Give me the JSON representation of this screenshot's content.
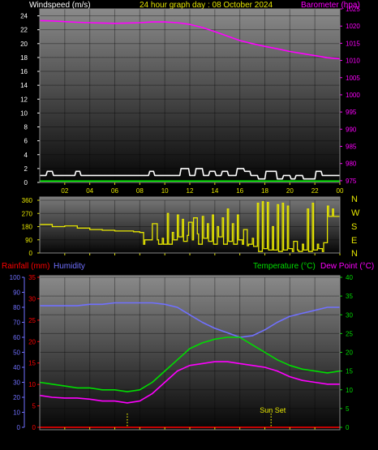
{
  "header": {
    "left_label": "Windspeed (m/s)",
    "center_label": "24 hour graph day : 08 October 2024",
    "right_label": "Barometer (hpa)"
  },
  "colors": {
    "wind": "#ffffff",
    "wind_avg": "#00ff00",
    "baro": "#ff00ff",
    "dir": "#e6e600",
    "rain": "#ff0000",
    "humidity": "#7070ff",
    "temperature": "#00dd00",
    "dewpoint": "#ff00ff",
    "time": "#e6e600",
    "sunset": "#e6e600"
  },
  "compass": [
    "N",
    "W",
    "S",
    "E",
    "N"
  ],
  "lower_header": {
    "rain_label": "Rainfall (mm)",
    "humidity_label": "Humidity",
    "temp_label": "Temperature (°C)",
    "dew_label": "Dew Point (°C)"
  },
  "sunset_label": "Sun Set",
  "chart_data": [
    {
      "type": "line",
      "xlabel": "",
      "xticks": [
        "02",
        "04",
        "06",
        "08",
        "10",
        "12",
        "14",
        "16",
        "18",
        "20",
        "22",
        "00"
      ],
      "xlim": [
        0,
        24
      ],
      "y_left": {
        "label": "Windspeed (m/s)",
        "lim": [
          0,
          25
        ],
        "ticks": [
          0,
          2,
          4,
          6,
          8,
          10,
          12,
          14,
          16,
          18,
          20,
          22,
          24
        ]
      },
      "y_right": {
        "label": "Barometer (hpa)",
        "lim": [
          974.5,
          1025
        ],
        "ticks": [
          975,
          980,
          985,
          990,
          995,
          1000,
          1005,
          1010,
          1015,
          1020,
          1025
        ]
      },
      "series": [
        {
          "name": "Windspeed",
          "axis": "left",
          "color_key": "wind",
          "x": [
            0,
            0.5,
            0.6,
            1.0,
            1.1,
            2.8,
            2.9,
            3.2,
            3.3,
            8.7,
            8.8,
            9.1,
            9.2,
            11.2,
            11.3,
            11.9,
            12.0,
            12.4,
            12.5,
            13.0,
            13.1,
            13.5,
            13.6,
            14.0,
            14.1,
            14.5,
            14.6,
            15.0,
            15.1,
            15.7,
            15.8,
            16.3,
            16.4,
            16.8,
            16.9,
            17.4,
            17.5,
            18.0,
            18.1,
            18.9,
            19.0,
            19.4,
            19.5,
            20.0,
            20.1,
            20.4,
            20.5,
            21.0,
            21.1,
            22.0,
            22.1,
            22.5,
            22.6,
            24
          ],
          "y": [
            1,
            1,
            1.6,
            1.6,
            1,
            1,
            1.6,
            1.6,
            1,
            1,
            1.6,
            1.6,
            1,
            1,
            2,
            2,
            1,
            1,
            2,
            2,
            1,
            1,
            1.6,
            1.6,
            1,
            1,
            1.6,
            1.6,
            1,
            1,
            2,
            2,
            1.6,
            1.6,
            1,
            1,
            0.5,
            0.5,
            1.6,
            1.6,
            0.5,
            0.5,
            1,
            1,
            0.5,
            0.5,
            1,
            1,
            0.5,
            0.5,
            1.6,
            1.6,
            1,
            1
          ]
        },
        {
          "name": "Wind average",
          "axis": "left",
          "color_key": "wind_avg",
          "x": [
            0,
            24
          ],
          "y": [
            0.2,
            0.2
          ]
        },
        {
          "name": "Barometer",
          "axis": "right",
          "color_key": "baro",
          "x": [
            0,
            1,
            2,
            3,
            4,
            5,
            6,
            7,
            8,
            9,
            10,
            11,
            12,
            13,
            14,
            15,
            16,
            17,
            18,
            19,
            20,
            21,
            22,
            23,
            24
          ],
          "y": [
            1021.6,
            1021.5,
            1021.3,
            1021.1,
            1021.0,
            1020.9,
            1020.8,
            1020.9,
            1021.0,
            1021.2,
            1021.2,
            1021.0,
            1020.5,
            1019.6,
            1018.4,
            1017.1,
            1015.8,
            1014.9,
            1014.1,
            1013.4,
            1012.6,
            1012.0,
            1011.4,
            1010.8,
            1010.5
          ]
        }
      ]
    },
    {
      "type": "line",
      "xlim": [
        0,
        24
      ],
      "y_left": {
        "label": "",
        "lim": [
          0,
          360
        ],
        "ticks": [
          0,
          90,
          180,
          270,
          360
        ]
      },
      "y_right": {
        "label": "",
        "ticks_text": [
          "N",
          "W",
          "S",
          "E",
          "N"
        ]
      },
      "series": [
        {
          "name": "Wind direction",
          "axis": "left",
          "color_key": "dir",
          "x": [
            0,
            1,
            2,
            3,
            4,
            5,
            6,
            7,
            7.5,
            8,
            8.3,
            8.4,
            9,
            9.4,
            9.5,
            9.8,
            9.9,
            10.2,
            10.3,
            10.6,
            10.7,
            11.0,
            11.1,
            11.4,
            11.5,
            11.8,
            11.9,
            12.2,
            12.3,
            12.6,
            12.7,
            13.0,
            13.1,
            13.4,
            13.5,
            13.8,
            13.9,
            14.2,
            14.3,
            14.6,
            14.7,
            15.0,
            15.1,
            15.4,
            15.5,
            15.8,
            15.9,
            16.2,
            16.3,
            16.6,
            16.7,
            17.0,
            17.1,
            17.4,
            17.5,
            17.8,
            17.9,
            18.2,
            18.3,
            18.6,
            18.7,
            19.0,
            19.1,
            19.4,
            19.5,
            19.8,
            19.9,
            20.2,
            20.3,
            20.6,
            20.7,
            21.0,
            21.1,
            21.4,
            21.5,
            21.8,
            21.9,
            22.2,
            22.3,
            22.6,
            22.7,
            23.0,
            23.1,
            23.4,
            23.5,
            24
          ],
          "y": [
            190,
            195,
            180,
            185,
            170,
            160,
            155,
            150,
            150,
            145,
            140,
            60,
            90,
            200,
            90,
            60,
            100,
            60,
            270,
            60,
            140,
            90,
            260,
            110,
            230,
            80,
            120,
            210,
            90,
            240,
            130,
            60,
            250,
            100,
            200,
            80,
            260,
            60,
            180,
            110,
            240,
            60,
            300,
            80,
            200,
            60,
            260,
            90,
            60,
            160,
            50,
            60,
            100,
            45,
            340,
            10,
            350,
            30,
            345,
            20,
            180,
            20,
            330,
            10,
            340,
            20,
            320,
            30,
            10,
            80,
            20,
            10,
            60,
            20,
            300,
            10,
            340,
            20,
            60,
            30,
            10,
            70,
            320,
            250,
            300,
            250
          ]
        }
      ]
    },
    {
      "type": "line",
      "xlim": [
        0,
        24
      ],
      "y_left_outer": {
        "label": "Humidity",
        "lim": [
          0,
          100
        ],
        "ticks": [
          0,
          10,
          20,
          30,
          40,
          50,
          60,
          70,
          80,
          90,
          100
        ]
      },
      "y_left_inner": {
        "label": "Rainfall (mm)",
        "lim": [
          0,
          35
        ],
        "ticks": [
          0,
          5,
          10,
          15,
          20,
          25,
          30,
          35
        ]
      },
      "y_right": {
        "label": "Temperature (°C)",
        "lim": [
          0,
          40
        ],
        "ticks": [
          0,
          5,
          10,
          15,
          20,
          25,
          30,
          35,
          40
        ]
      },
      "series": [
        {
          "name": "Humidity",
          "axis": "humidity",
          "color_key": "humidity",
          "x": [
            0,
            1,
            2,
            3,
            4,
            5,
            6,
            7,
            8,
            9,
            10,
            11,
            12,
            13,
            14,
            15,
            16,
            17,
            18,
            19,
            20,
            21,
            22,
            23,
            24
          ],
          "y": [
            81,
            81,
            81,
            81,
            82,
            82,
            83,
            83,
            83,
            83,
            82,
            80,
            75,
            70,
            66,
            63,
            60,
            61,
            65,
            70,
            74,
            76,
            78,
            80,
            80
          ]
        },
        {
          "name": "Temperature",
          "axis": "right",
          "color_key": "temperature",
          "x": [
            0,
            1,
            2,
            3,
            4,
            5,
            6,
            7,
            8,
            9,
            10,
            11,
            12,
            13,
            14,
            15,
            16,
            17,
            18,
            19,
            20,
            21,
            22,
            23,
            24
          ],
          "y": [
            12,
            11.5,
            11,
            10.5,
            10.5,
            10,
            10,
            9.5,
            10,
            12,
            15,
            18,
            21,
            22.5,
            23.5,
            24,
            24,
            22,
            20,
            18,
            16.5,
            15.5,
            15,
            14.5,
            15
          ]
        },
        {
          "name": "Dew Point",
          "axis": "right",
          "color_key": "dewpoint",
          "x": [
            0,
            1,
            2,
            3,
            4,
            5,
            6,
            7,
            8,
            9,
            10,
            11,
            12,
            13,
            14,
            15,
            16,
            17,
            18,
            19,
            20,
            21,
            22,
            23,
            24
          ],
          "y": [
            8.5,
            8,
            7.8,
            7.8,
            7.5,
            7,
            7,
            6.5,
            7,
            9,
            12,
            15,
            16.5,
            17,
            17.5,
            17.5,
            17,
            16.5,
            16,
            15,
            13.5,
            12.5,
            12,
            11.5,
            11.5
          ]
        },
        {
          "name": "Rainfall",
          "axis": "rain",
          "color_key": "rain",
          "x": [
            0,
            24
          ],
          "y": [
            0,
            0
          ]
        }
      ],
      "annotations": [
        {
          "text": "",
          "x": 7,
          "kind": "sunrise-marker"
        },
        {
          "text": "Sun Set",
          "x": 18.5,
          "kind": "sunset-marker"
        }
      ]
    }
  ]
}
